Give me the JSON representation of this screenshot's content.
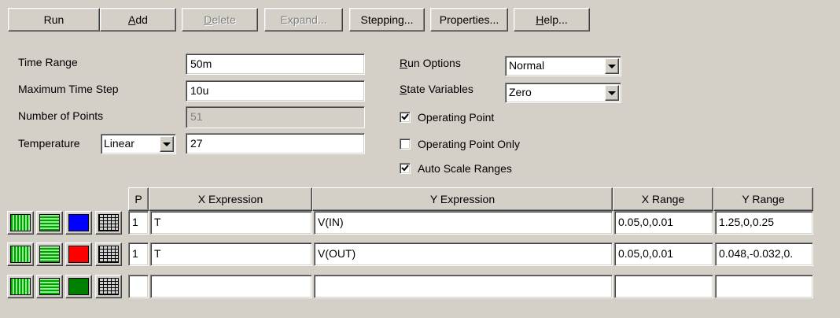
{
  "toolbar": {
    "run": "Run",
    "add": "Add",
    "delete": "Delete",
    "expand": "Expand...",
    "stepping": "Stepping...",
    "properties": "Properties...",
    "help": "Help..."
  },
  "params": {
    "time_range_label": "Time Range",
    "time_range_value": "50m",
    "max_step_label": "Maximum Time Step",
    "max_step_value": "10u",
    "num_points_label": "Number of Points",
    "num_points_value": "51",
    "temperature_label": "Temperature",
    "temperature_mode": "Linear",
    "temperature_value": "27"
  },
  "options": {
    "run_options_label": "Run Options",
    "run_options_value": "Normal",
    "state_vars_label": "State Variables",
    "state_vars_value": "Zero",
    "op_point_label": "Operating Point",
    "op_point_checked": true,
    "op_only_label": "Operating Point Only",
    "op_only_checked": false,
    "auto_scale_label": "Auto Scale Ranges",
    "auto_scale_checked": true
  },
  "grid": {
    "headers": {
      "p": "P",
      "x_expr": "X Expression",
      "y_expr": "Y Expression",
      "x_range": "X Range",
      "y_range": "Y Range"
    },
    "rows": [
      {
        "color": "#0000ff",
        "p": "1",
        "x_expr": "T",
        "y_expr": "V(IN)",
        "x_range": "0.05,0,0.01",
        "y_range": "1.25,0,0.25"
      },
      {
        "color": "#ff0000",
        "p": "1",
        "x_expr": "T",
        "y_expr": "V(OUT)",
        "x_range": "0.05,0,0.01",
        "y_range": "0.048,-0.032,0."
      },
      {
        "color": "#008000",
        "p": "",
        "x_expr": "",
        "y_expr": "",
        "x_range": "",
        "y_range": ""
      }
    ]
  }
}
